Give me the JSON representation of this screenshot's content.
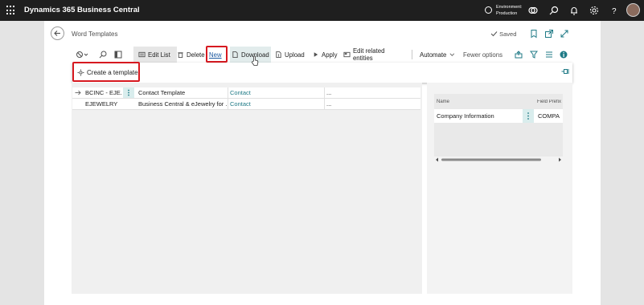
{
  "app": {
    "title": "Dynamics 365 Business Central"
  },
  "environment": {
    "label": "Environment:",
    "name": "Production"
  },
  "page": {
    "title": "Word Templates",
    "status": "Saved"
  },
  "actions": {
    "edit_list": "Edit List",
    "delete": "Delete",
    "new": "New",
    "download": "Download",
    "upload": "Upload",
    "apply": "Apply",
    "edit_related": "Edit related entities",
    "automate": "Automate",
    "fewer_options": "Fewer options"
  },
  "new_menu": {
    "create_template": "Create a template"
  },
  "templates": {
    "rows": [
      {
        "code": "BCINC - EJE...",
        "name": "Contact Template",
        "table": "Contact",
        "extra": "..."
      },
      {
        "code": "EJEWELRY",
        "name": "Business Central & eJewelry for ...",
        "table": "Contact",
        "extra": "..."
      }
    ]
  },
  "factbox": {
    "col_name": "Name",
    "col_prefix": "Field Prefix",
    "row": {
      "name": "Company Information",
      "prefix": "COMPA"
    }
  },
  "colors": {
    "highlight": "#d71920",
    "link": "#1f7a86",
    "topbar": "#1f1f1f"
  }
}
